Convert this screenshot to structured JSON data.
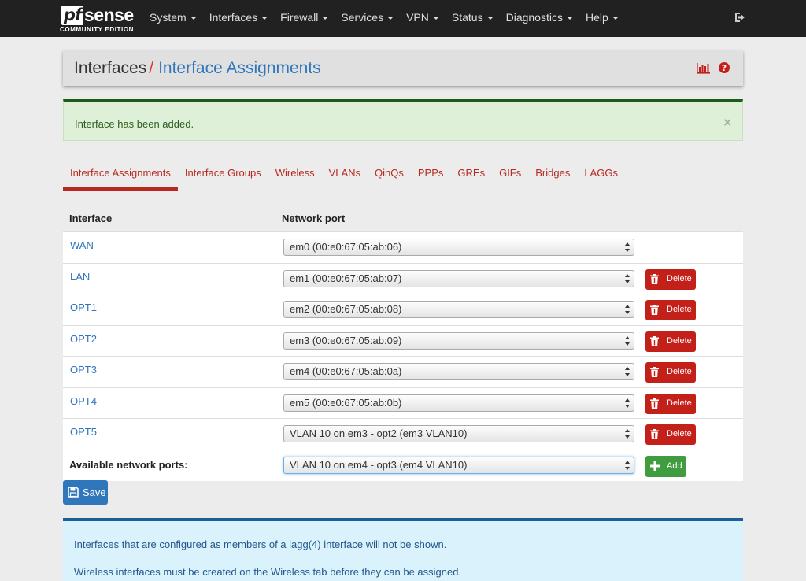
{
  "brand": {
    "mark": "pf",
    "name": "sense",
    "edition": "COMMUNITY EDITION"
  },
  "nav": {
    "items": [
      "System",
      "Interfaces",
      "Firewall",
      "Services",
      "VPN",
      "Status",
      "Diagnostics",
      "Help"
    ]
  },
  "breadcrumb": {
    "parent": "Interfaces",
    "separator": "/",
    "current": "Interface Assignments"
  },
  "alert": {
    "message": "Interface has been added.",
    "close": "×"
  },
  "tabs": [
    "Interface Assignments",
    "Interface Groups",
    "Wireless",
    "VLANs",
    "QinQs",
    "PPPs",
    "GREs",
    "GIFs",
    "Bridges",
    "LAGGs"
  ],
  "active_tab": "Interface Assignments",
  "table": {
    "headers": {
      "interface": "Interface",
      "port": "Network port"
    },
    "rows": [
      {
        "interface": "WAN",
        "port": "em0 (00:e0:67:05:ab:06)",
        "delete": ""
      },
      {
        "interface": "LAN",
        "port": "em1 (00:e0:67:05:ab:07)",
        "delete": "Delete"
      },
      {
        "interface": "OPT1",
        "port": "em2 (00:e0:67:05:ab:08)",
        "delete": "Delete"
      },
      {
        "interface": "OPT2",
        "port": "em3 (00:e0:67:05:ab:09)",
        "delete": "Delete"
      },
      {
        "interface": "OPT3",
        "port": "em4 (00:e0:67:05:ab:0a)",
        "delete": "Delete"
      },
      {
        "interface": "OPT4",
        "port": "em5 (00:e0:67:05:ab:0b)",
        "delete": "Delete"
      },
      {
        "interface": "OPT5",
        "port": "VLAN 10 on em3 - opt2 (em3 VLAN10)",
        "delete": "Delete"
      }
    ],
    "available": {
      "label": "Available network ports:",
      "port": "VLAN 10 on em4 - opt3 (em4 VLAN10)",
      "add": "Add"
    }
  },
  "save_label": "Save",
  "info": [
    "Interfaces that are configured as members of a lagg(4) interface will not be shown.",
    "Wireless interfaces must be created on the Wireless tab before they can be assigned."
  ],
  "colors": {
    "navbar": "#212121",
    "accent_red": "#b7291f",
    "link_blue": "#2f76bb",
    "delete_red": "#c4201a",
    "add_green": "#3f9d3f"
  }
}
